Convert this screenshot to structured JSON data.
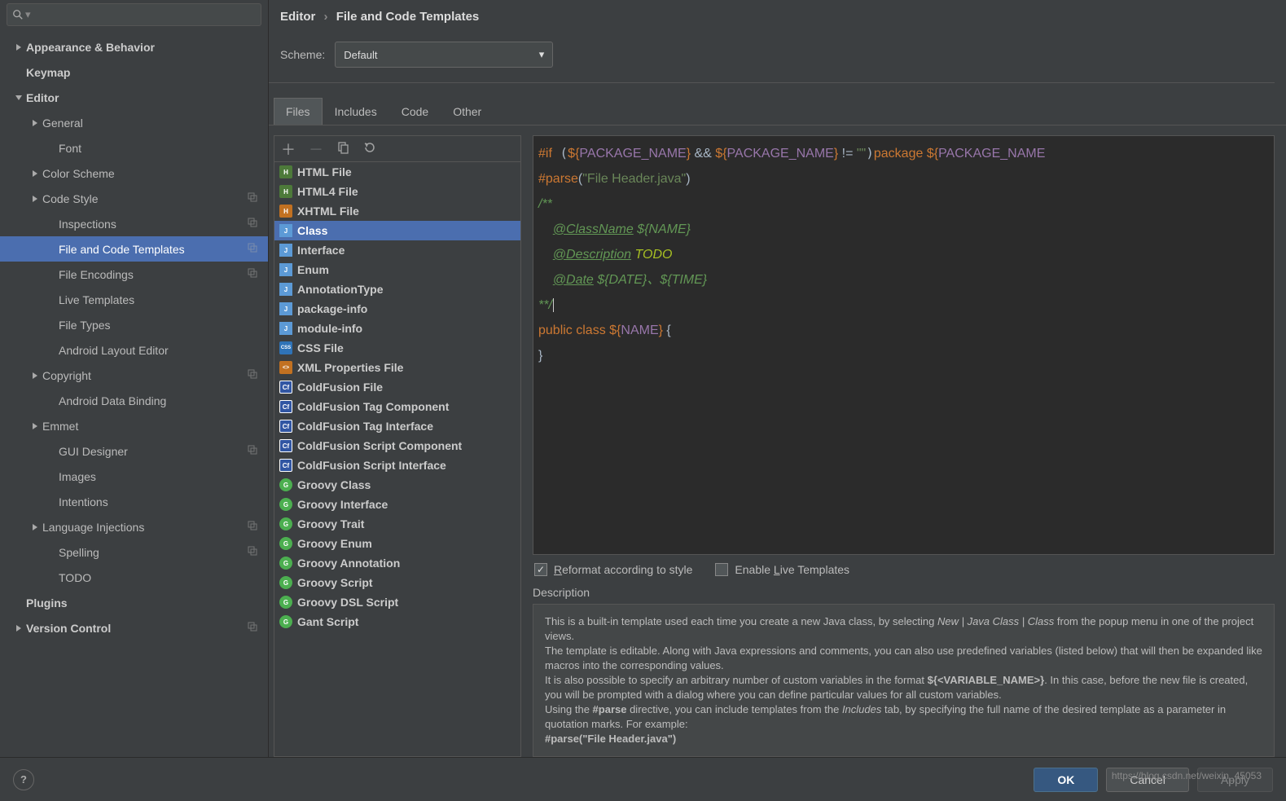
{
  "breadcrumb": {
    "root": "Editor",
    "page": "File and Code Templates"
  },
  "scheme": {
    "label": "Scheme:",
    "value": "Default"
  },
  "sidebar": {
    "search_placeholder": "",
    "items": [
      {
        "label": "Appearance & Behavior",
        "level": 0,
        "arrow": "right",
        "bold": true
      },
      {
        "label": "Keymap",
        "level": 0,
        "arrow": "",
        "bold": true
      },
      {
        "label": "Editor",
        "level": 0,
        "arrow": "down",
        "bold": true
      },
      {
        "label": "General",
        "level": 1,
        "arrow": "right"
      },
      {
        "label": "Font",
        "level": 2,
        "arrow": ""
      },
      {
        "label": "Color Scheme",
        "level": 1,
        "arrow": "right"
      },
      {
        "label": "Code Style",
        "level": 1,
        "arrow": "right",
        "badge": true
      },
      {
        "label": "Inspections",
        "level": 2,
        "arrow": "",
        "badge": true
      },
      {
        "label": "File and Code Templates",
        "level": 2,
        "arrow": "",
        "badge": true,
        "selected": true
      },
      {
        "label": "File Encodings",
        "level": 2,
        "arrow": "",
        "badge": true
      },
      {
        "label": "Live Templates",
        "level": 2,
        "arrow": ""
      },
      {
        "label": "File Types",
        "level": 2,
        "arrow": ""
      },
      {
        "label": "Android Layout Editor",
        "level": 2,
        "arrow": ""
      },
      {
        "label": "Copyright",
        "level": 1,
        "arrow": "right",
        "badge": true
      },
      {
        "label": "Android Data Binding",
        "level": 2,
        "arrow": ""
      },
      {
        "label": "Emmet",
        "level": 1,
        "arrow": "right"
      },
      {
        "label": "GUI Designer",
        "level": 2,
        "arrow": "",
        "badge": true
      },
      {
        "label": "Images",
        "level": 2,
        "arrow": ""
      },
      {
        "label": "Intentions",
        "level": 2,
        "arrow": ""
      },
      {
        "label": "Language Injections",
        "level": 1,
        "arrow": "right",
        "badge": true
      },
      {
        "label": "Spelling",
        "level": 2,
        "arrow": "",
        "badge": true
      },
      {
        "label": "TODO",
        "level": 2,
        "arrow": ""
      },
      {
        "label": "Plugins",
        "level": 0,
        "arrow": "",
        "bold": true
      },
      {
        "label": "Version Control",
        "level": 0,
        "arrow": "right",
        "bold": true,
        "badge": true
      }
    ]
  },
  "tabs": [
    {
      "label": "Files",
      "active": true
    },
    {
      "label": "Includes"
    },
    {
      "label": "Code"
    },
    {
      "label": "Other"
    }
  ],
  "templates": [
    {
      "label": "HTML File",
      "ico": "ico-h",
      "t": "H"
    },
    {
      "label": "HTML4 File",
      "ico": "ico-h4",
      "t": "H"
    },
    {
      "label": "XHTML File",
      "ico": "ico-x",
      "t": "H"
    },
    {
      "label": "Class",
      "ico": "ico-j",
      "t": "J",
      "selected": true
    },
    {
      "label": "Interface",
      "ico": "ico-j",
      "t": "J"
    },
    {
      "label": "Enum",
      "ico": "ico-j",
      "t": "J"
    },
    {
      "label": "AnnotationType",
      "ico": "ico-j",
      "t": "J"
    },
    {
      "label": "package-info",
      "ico": "ico-j",
      "t": "J"
    },
    {
      "label": "module-info",
      "ico": "ico-j",
      "t": "J"
    },
    {
      "label": "CSS File",
      "ico": "ico-css",
      "t": "CSS"
    },
    {
      "label": "XML Properties File",
      "ico": "ico-xml",
      "t": "<>"
    },
    {
      "label": "ColdFusion File",
      "ico": "ico-cf",
      "t": "Cf"
    },
    {
      "label": "ColdFusion Tag Component",
      "ico": "ico-cf",
      "t": "Cf"
    },
    {
      "label": "ColdFusion Tag Interface",
      "ico": "ico-cf",
      "t": "Cf"
    },
    {
      "label": "ColdFusion Script Component",
      "ico": "ico-cf",
      "t": "Cf"
    },
    {
      "label": "ColdFusion Script Interface",
      "ico": "ico-cf",
      "t": "Cf"
    },
    {
      "label": "Groovy Class",
      "ico": "ico-g",
      "t": "G"
    },
    {
      "label": "Groovy Interface",
      "ico": "ico-g",
      "t": "G"
    },
    {
      "label": "Groovy Trait",
      "ico": "ico-g",
      "t": "G"
    },
    {
      "label": "Groovy Enum",
      "ico": "ico-g",
      "t": "G"
    },
    {
      "label": "Groovy Annotation",
      "ico": "ico-g",
      "t": "G"
    },
    {
      "label": "Groovy Script",
      "ico": "ico-g",
      "t": "G"
    },
    {
      "label": "Groovy DSL Script",
      "ico": "ico-g",
      "t": "G"
    },
    {
      "label": "Gant Script",
      "ico": "ico-g",
      "t": "G"
    }
  ],
  "code": {
    "l1a": "#if",
    "l1b": "${",
    "l1c": "PACKAGE_NAME",
    "l1d": "}",
    "l1e": " && ",
    "l1f": "${",
    "l1g": "PACKAGE_NAME",
    "l1h": "}",
    "l1i": " != ",
    "l1j": "\"\"",
    "l1k": "package ",
    "l1l": "${",
    "l1m": "PACKAGE_NAME",
    "l2a": "#parse",
    "l2b": "(",
    "l2c": "\"File Header.java\"",
    "l2d": ")",
    "l3": "/**",
    "l4a": "@ClassName",
    "l4b": " ${NAME}",
    "l5a": "@Description",
    "l5b": " TODO",
    "l6a": "@Date",
    "l6b": " ${DATE}、${TIME}",
    "l7": "**/",
    "l8a": "public class ",
    "l8b": "${",
    "l8c": "NAME",
    "l8d": "}",
    "l8e": " {",
    "l9": "}"
  },
  "checks": {
    "reformat": "Reformat according to style",
    "live": "Enable Live Templates"
  },
  "desc": {
    "label": "Description",
    "p1a": "This is a built-in template used each time you create a new Java class, by selecting ",
    "p1b": "New | Java Class | Class",
    "p1c": " from the popup menu in one of the project views.",
    "p2": "The template is editable. Along with Java expressions and comments, you can also use predefined variables (listed below) that will then be expanded like macros into the corresponding values.",
    "p3a": "It is also possible to specify an arbitrary number of custom variables in the format ",
    "p3b": "${<VARIABLE_NAME>}",
    "p3c": ". In this case, before the new file is created, you will be prompted with a dialog where you can define particular values for all custom variables.",
    "p4a": "Using the ",
    "p4b": "#parse",
    "p4c": " directive, you can include templates from the ",
    "p4d": "Includes",
    "p4e": " tab, by specifying the full name of the desired template as a parameter in quotation marks. For example:",
    "p5": "#parse(\"File Header.java\")"
  },
  "footer": {
    "ok": "OK",
    "cancel": "Cancel",
    "apply": "Apply"
  },
  "watermark": "https://blog.csdn.net/weixin_45053"
}
